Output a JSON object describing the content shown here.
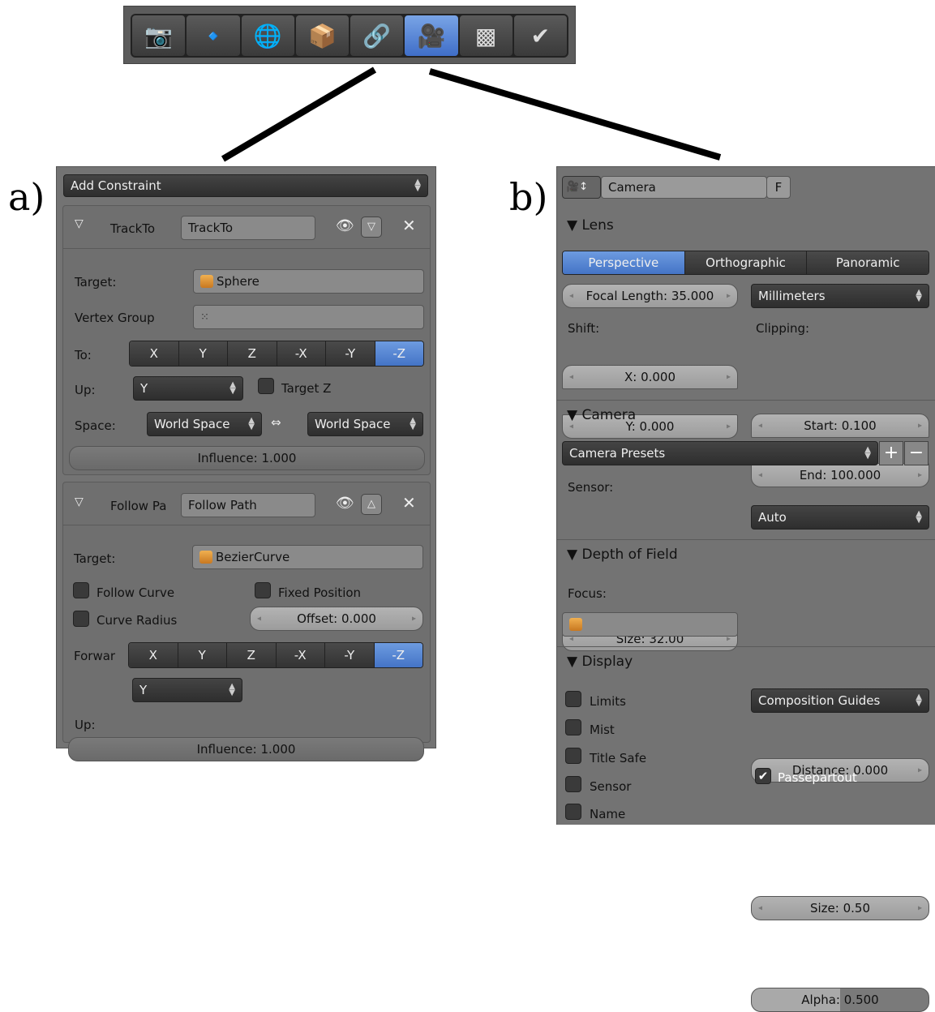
{
  "tabs": [
    {
      "icon": "render-icon",
      "glyph": "📷"
    },
    {
      "icon": "scene-icon",
      "glyph": "🔹"
    },
    {
      "icon": "world-icon",
      "glyph": "🌐"
    },
    {
      "icon": "object-icon",
      "glyph": "📦"
    },
    {
      "icon": "constraints-icon",
      "glyph": "🔗"
    },
    {
      "icon": "camera-data-icon",
      "glyph": "🎥"
    },
    {
      "icon": "texture-icon",
      "glyph": "▩"
    },
    {
      "icon": "material-icon",
      "glyph": "✔"
    }
  ],
  "label_a": "a)",
  "label_b": "b)",
  "a": {
    "add_constraint": "Add Constraint",
    "c1": {
      "type": "TrackTo",
      "name": "TrackTo",
      "target_label": "Target:",
      "target": "Sphere",
      "vgroup_label": "Vertex Group",
      "to_label": "To:",
      "axes": [
        "X",
        "Y",
        "Z",
        "-X",
        "-Y",
        "-Z"
      ],
      "active_axis": "-Z",
      "up_label": "Up:",
      "up": "Y",
      "targetz": "Target Z",
      "space_label": "Space:",
      "space1": "World Space",
      "space2": "World Space",
      "arrow": "⇔",
      "influence": "Influence: 1.000"
    },
    "c2": {
      "type": "Follow Pa",
      "name": "Follow Path",
      "target_label": "Target:",
      "target": "BezierCurve",
      "follow_curve": "Follow Curve",
      "fixed_position": "Fixed Position",
      "curve_radius": "Curve Radius",
      "offset": "Offset: 0.000",
      "forward_label": "Forwar",
      "axes": [
        "X",
        "Y",
        "Z",
        "-X",
        "-Y",
        "-Z"
      ],
      "active_axis": "-Z",
      "up_label": "Up:",
      "up": "Y",
      "influence": "Influence: 1.000"
    }
  },
  "b": {
    "name": "Camera",
    "f": "F",
    "lens": {
      "title": "Lens",
      "types": [
        "Perspective",
        "Orthographic",
        "Panoramic"
      ],
      "active": "Perspective",
      "focal": "Focal Length: 35.000",
      "unit": "Millimeters",
      "shift_label": "Shift:",
      "clip_label": "Clipping:",
      "shift_x": "X: 0.000",
      "shift_y": "Y: 0.000",
      "start": "Start: 0.100",
      "end": "End: 100.000"
    },
    "camera": {
      "title": "Camera",
      "presets": "Camera Presets",
      "sensor_label": "Sensor:",
      "size": "Size: 32.00",
      "fit": "Auto"
    },
    "dof": {
      "title": "Depth of Field",
      "focus_label": "Focus:",
      "distance": "Distance: 0.000"
    },
    "display": {
      "title": "Display",
      "limits": "Limits",
      "mist": "Mist",
      "title_safe": "Title Safe",
      "sensor": "Sensor",
      "name": "Name",
      "guides": "Composition Guides",
      "size": "Size: 0.50",
      "passepartout": "Passepartout",
      "alpha": "Alpha: 0.500"
    }
  }
}
